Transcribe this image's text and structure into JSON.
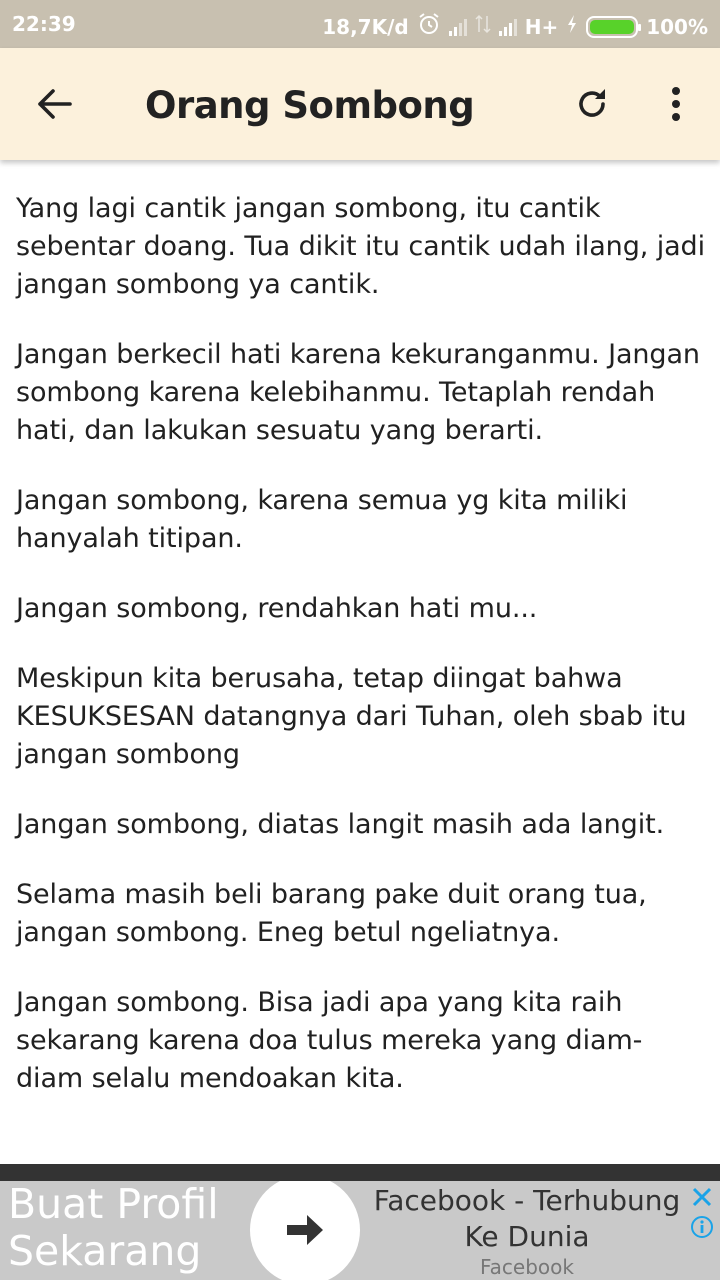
{
  "status_bar": {
    "time": "22:39",
    "net_speed": "18,7K/d",
    "network_type": "H+",
    "battery": "100%",
    "battery_level": 100,
    "battery_color": "#58d22a",
    "icons": [
      "alarm-icon",
      "signal-icon",
      "data-arrows-icon",
      "signal-icon",
      "charging-icon",
      "battery-icon"
    ]
  },
  "app_bar": {
    "title": "Orang Sombong",
    "background": "#fcf1dc",
    "icons": [
      "back-arrow-icon",
      "refresh-icon",
      "more-vert-icon"
    ]
  },
  "quotes": [
    "Yang lagi cantik jangan sombong, itu cantik sebentar doang. Tua dikit itu cantik udah ilang, jadi jangan sombong ya cantik.",
    "Jangan berkecil hati karena kekuranganmu. Jangan sombong karena kelebihanmu. Tetaplah rendah hati, dan lakukan sesuatu yang berarti.",
    "Jangan sombong, karena semua yg kita miliki hanyalah titipan.",
    "Jangan sombong, rendahkan hati mu...",
    "Meskipun kita berusaha, tetap diingat bahwa KESUKSESAN datangnya dari Tuhan, oleh sbab itu jangan sombong",
    "Jangan sombong, diatas langit masih ada langit.",
    "Selama masih beli barang pake duit orang tua, jangan sombong. Eneg betul ngeliatnya.",
    "Jangan sombong. Bisa jadi apa yang kita raih sekarang karena doa tulus mereka yang diam-diam selalu mendoakan kita."
  ],
  "ad": {
    "headline": "Buat Profil Sekarang",
    "title": "Facebook - Terhubung Ke Dunia",
    "source": "Facebook",
    "accent": "#1aa3e8",
    "icons": [
      "arrow-right-icon",
      "close-icon",
      "info-icon"
    ]
  }
}
